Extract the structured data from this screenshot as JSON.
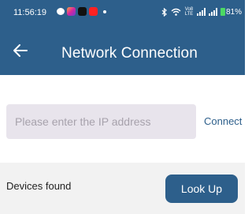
{
  "status_bar": {
    "time": "11:56:19",
    "network_label": "Vo8 LTE",
    "battery_percent": "81%",
    "left_icons": [
      "message-icon",
      "instagram-icon",
      "tiktok-icon",
      "youtube-icon",
      "dot-icon"
    ],
    "right_icons": [
      "bluetooth-icon",
      "wifi-icon",
      "signal-icon",
      "signal-icon",
      "battery-icon"
    ]
  },
  "header": {
    "title": "Network Connection",
    "back_icon": "back-arrow-icon",
    "background_color": "#2d5f8b"
  },
  "ip_form": {
    "placeholder": "Please enter the IP address",
    "value": "",
    "connect_label": "Connect"
  },
  "devices": {
    "label": "Devices found",
    "lookup_label": "Look Up"
  }
}
